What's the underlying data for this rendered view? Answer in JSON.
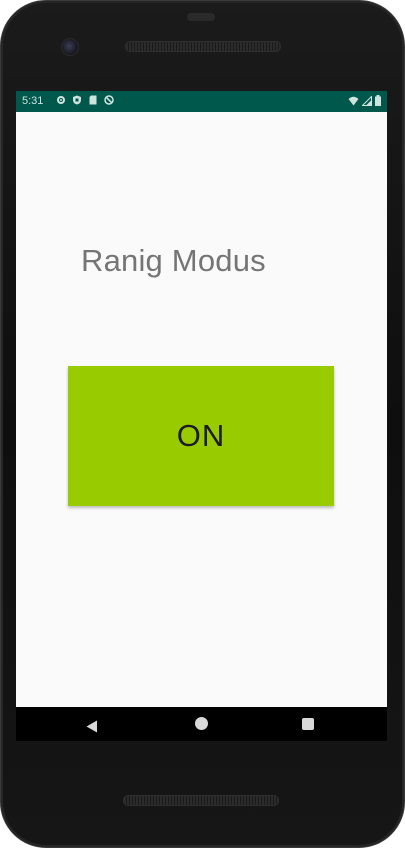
{
  "status_bar": {
    "time": "5:31",
    "left_icons": [
      "settings-icon",
      "shield-icon",
      "sd-card-icon",
      "do-not-disturb-icon"
    ],
    "right_icons": [
      "wifi-icon",
      "signal-icon",
      "battery-icon"
    ],
    "background_color": "#00574b"
  },
  "main": {
    "title": "Ranig Modus",
    "toggle_button": {
      "label": "ON",
      "color": "#99cc00"
    }
  },
  "nav_bar": {
    "items": [
      "back-icon",
      "home-icon",
      "recents-icon"
    ]
  }
}
